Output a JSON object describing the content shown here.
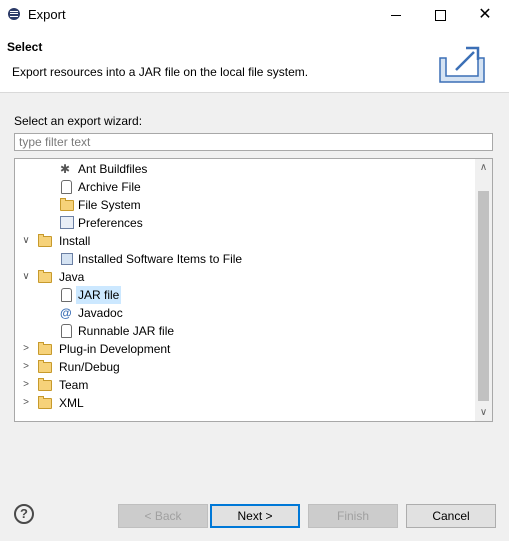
{
  "window": {
    "title": "Export"
  },
  "header": {
    "title": "Select",
    "description": "Export resources into a JAR file on the local file system."
  },
  "wizard": {
    "label": "Select an export wizard:",
    "filter_placeholder": "type filter text",
    "filter_value": ""
  },
  "tree": {
    "items": [
      {
        "label": "Ant Buildfiles",
        "icon": "ant-icon",
        "depth": 1
      },
      {
        "label": "Archive File",
        "icon": "archive-file-icon",
        "depth": 1
      },
      {
        "label": "File System",
        "icon": "folder-icon",
        "depth": 1
      },
      {
        "label": "Preferences",
        "icon": "preferences-icon",
        "depth": 1
      },
      {
        "label": "Install",
        "icon": "folder-icon",
        "depth": 0,
        "expanded": true
      },
      {
        "label": "Installed Software Items to File",
        "icon": "installed-software-icon",
        "depth": 1
      },
      {
        "label": "Java",
        "icon": "folder-icon",
        "depth": 0,
        "expanded": true
      },
      {
        "label": "JAR file",
        "icon": "jar-icon",
        "depth": 1,
        "selected": true
      },
      {
        "label": "Javadoc",
        "icon": "javadoc-icon",
        "depth": 1
      },
      {
        "label": "Runnable JAR file",
        "icon": "runnable-jar-icon",
        "depth": 1
      },
      {
        "label": "Plug-in Development",
        "icon": "folder-icon",
        "depth": 0,
        "expanded": false
      },
      {
        "label": "Run/Debug",
        "icon": "folder-icon",
        "depth": 0,
        "expanded": false
      },
      {
        "label": "Team",
        "icon": "folder-icon",
        "depth": 0,
        "expanded": false
      },
      {
        "label": "XML",
        "icon": "folder-icon",
        "depth": 0,
        "expanded": false
      }
    ]
  },
  "buttons": {
    "help": "?",
    "back": "< Back",
    "next": "Next >",
    "finish": "Finish",
    "cancel": "Cancel"
  },
  "colors": {
    "selection": "#cce8ff",
    "default_button_border": "#0078d7",
    "folder": "#f6d27a"
  }
}
